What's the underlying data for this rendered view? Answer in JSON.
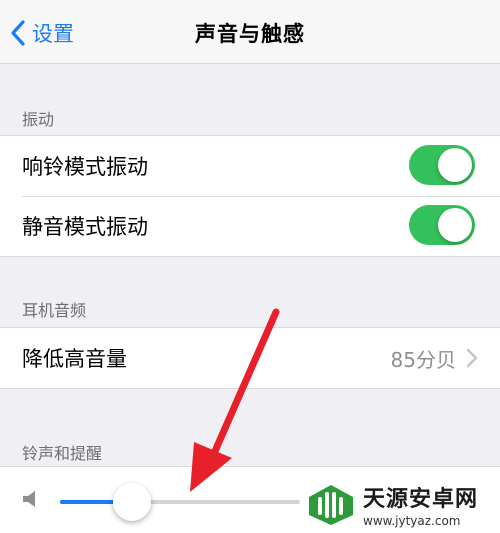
{
  "nav": {
    "back_label": "设置",
    "title": "声音与触感"
  },
  "sections": [
    {
      "header": "振动",
      "rows": [
        {
          "label": "响铃模式振动",
          "toggle": "on"
        },
        {
          "label": "静音模式振动",
          "toggle": "on"
        }
      ]
    },
    {
      "header": "耳机音频",
      "rows": [
        {
          "label": "降低高音量",
          "detail": "85分贝"
        }
      ]
    },
    {
      "header": "铃声和提醒",
      "slider": {
        "value_fraction": 0.3
      }
    }
  ],
  "icons": {
    "back": "chevron-left-icon",
    "disclosure": "chevron-right-icon",
    "speaker": "speaker-icon",
    "annotation": "red-arrow"
  },
  "colors": {
    "accent": "#1a7cf3",
    "toggle_on": "#34c05a",
    "arrow": "#e8202a",
    "background": "#efeff4"
  },
  "watermark": {
    "name": "天源安卓网",
    "url": "www.jytyaz.com"
  }
}
